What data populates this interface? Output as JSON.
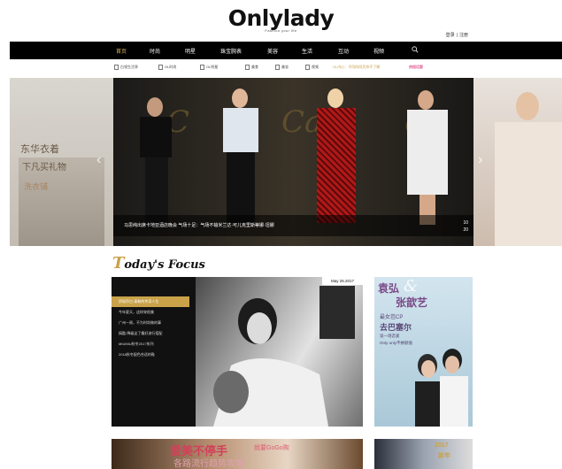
{
  "header": {
    "logo": "Onlylady",
    "tagline": "Fashion your life",
    "login_label": "登录",
    "separator": "|",
    "register_label": "注册"
  },
  "nav": {
    "items": [
      "首页",
      "时尚",
      "明星",
      "珠宝腕表",
      "美容",
      "生活",
      "互动",
      "视频"
    ],
    "active_index": 0,
    "search_icon": "search-icon"
  },
  "subnav": {
    "items": [
      "白领生活季",
      "OL时尚",
      "OL明星",
      "美食",
      "美妆",
      "视频"
    ],
    "highlight": "OL内心：不同的网页你不了解",
    "highlight2": "热搜话题"
  },
  "hero": {
    "left_title": "东华衣着",
    "left_subtitle": "下凡买礼物",
    "left_tagline": "洗衣铺",
    "caption": "马思纯出席卡地亚酒店晚会   气场十足：气场不输米兰达·可儿克里斯蒂娜·坦娜",
    "counter_current": "10",
    "counter_total": "20",
    "prev_arrow": "‹",
    "next_arrow": "›"
  },
  "focus": {
    "title_letter": "T",
    "title_rest": "oday's",
    "title_word": "Focus",
    "date": "May 26.2017",
    "list": [
      "伊丽莎白·泰勒的传奇人生",
      "今年夏天，这样穿很美",
      "广州一周，不为时尚做的事",
      "搞酷·降级这了最好流行搭配",
      "MIUMIU秋冬2017系列",
      "2018秋冬配色合适的鞋"
    ],
    "active_index": 0
  },
  "side": {
    "name1": "袁弘",
    "amp": "&",
    "name2": "张歆艺",
    "sub1": "最女芭CP",
    "sub2": "去巴塞尔",
    "sub3": "谈一场恋爱",
    "sub4": "Only·only不拼颜值"
  },
  "banner1": {
    "title": "爱美不停手",
    "subtitle": "就要GoGo购",
    "line2": "各路流行趋势攻略"
  },
  "banner2": {
    "line1": "2017",
    "line2": "新年 "
  }
}
